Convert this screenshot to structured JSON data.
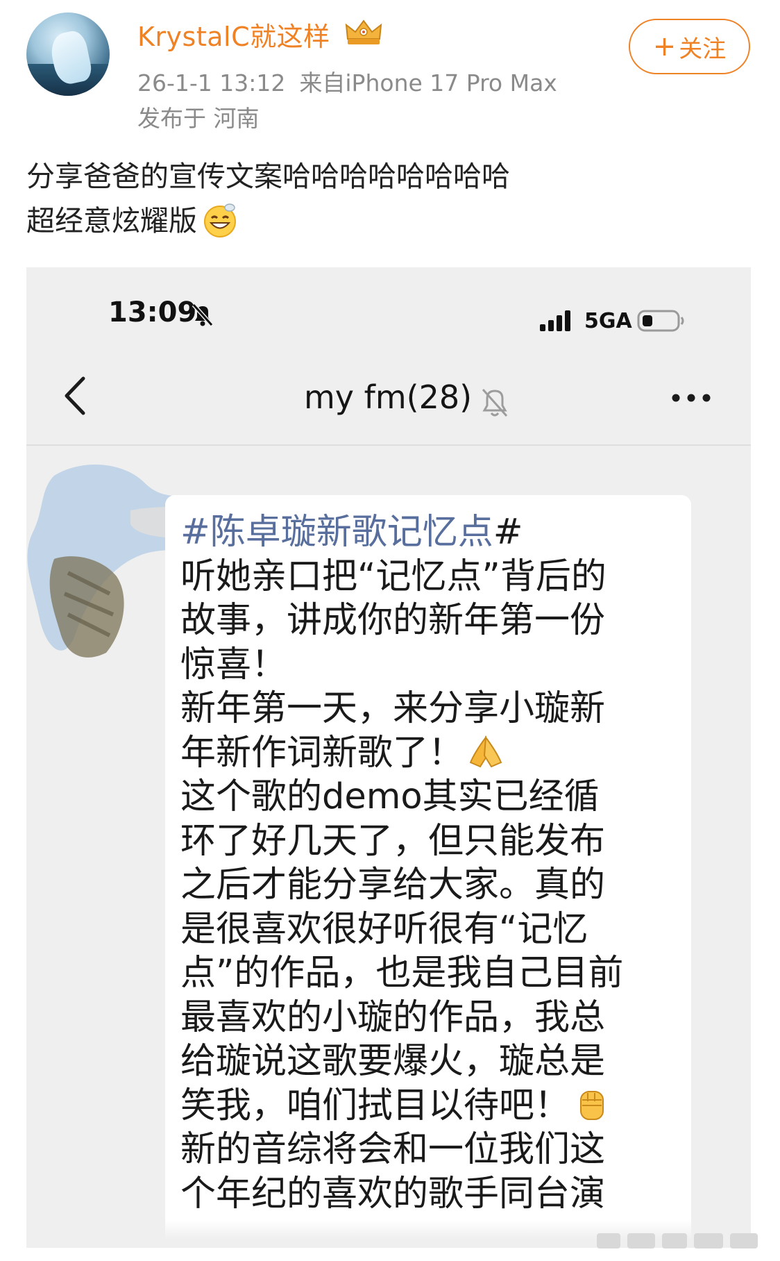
{
  "post": {
    "username": "KrystalC就这样",
    "timestamp": "26-1-1 13:12",
    "device": "来自iPhone 17 Pro Max",
    "location": "发布于 河南",
    "follow_label": "关注",
    "text_line1": "分享爸爸的宣传文案哈哈哈哈哈哈哈哈",
    "text_line2": "超经意炫耀版"
  },
  "screenshot": {
    "status_bar": {
      "time": "13:09",
      "network": "5GA"
    },
    "chat": {
      "title": "my fm(28)",
      "message": {
        "hashtag": "#陈卓璇新歌记忆点",
        "hashtag_end": "#",
        "lines": [
          "听她亲口把“记忆点”背后的",
          "故事，讲成你的新年第一份",
          "惊喜！",
          "新年第一天，来分享小璇新",
          "年新作词新歌了！",
          "这个歌的demo其实已经循",
          "环了好几天了，但只能发布",
          "之后才能分享给大家。真的",
          "是很喜欢很好听很有“记忆",
          "点”的作品，也是我自己目前",
          "最喜欢的小璇的作品，我总",
          "给璇说这歌要爆火，璇总是",
          "笑我，咱们拭目以待吧！",
          "新的音综将会和一位我们这",
          "个年纪的喜欢的歌手同台演"
        ]
      }
    }
  },
  "icons": [
    "crown-badge-icon",
    "plus-icon",
    "grin-emoji-icon",
    "bell-slash-icon",
    "signal-icon",
    "battery-icon",
    "back-chevron-icon",
    "mute-bell-icon",
    "more-dots-icon",
    "praying-hands-emoji-icon",
    "raised-fist-emoji-icon"
  ],
  "colors": {
    "accent": "#f08226",
    "meta": "#8a8a8a",
    "hashtag": "#586e9c",
    "chat_bg": "#efefef"
  }
}
